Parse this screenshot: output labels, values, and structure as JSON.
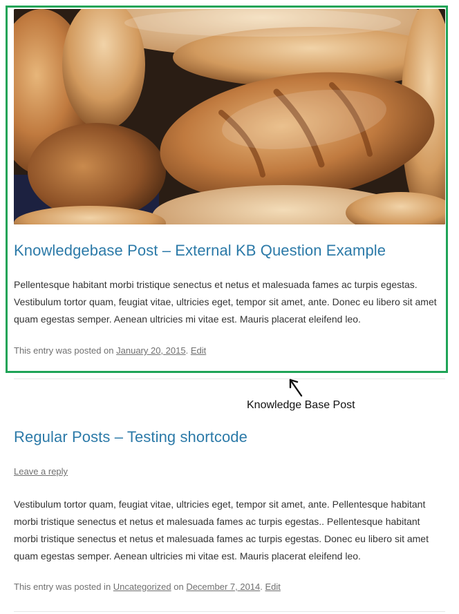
{
  "kb_post": {
    "title": "Knowledgebase Post – External KB Question Example",
    "excerpt": "Pellentesque habitant morbi tristique senectus et netus et malesuada fames ac turpis egestas. Vestibulum tortor quam, feugiat vitae, ultricies eget, tempor sit amet, ante. Donec eu libero sit amet quam egestas semper. Aenean ultricies mi vitae est. Mauris placerat eleifend leo.",
    "meta_prefix": "This entry was posted on ",
    "date": "January 20, 2015",
    "sep": ". ",
    "edit": "Edit",
    "image_icon": "bread-photo-icon",
    "highlight_color": "#1fa457"
  },
  "annotation": {
    "label": "Knowledge Base Post",
    "icon": "arrow-icon"
  },
  "regular_post": {
    "title": "Regular Posts – Testing shortcode",
    "reply": "Leave a reply",
    "body": "Vestibulum tortor quam, feugiat vitae, ultricies eget, tempor sit amet, ante. Pellentesque habitant morbi tristique senectus et netus et malesuada fames ac turpis egestas.. Pellentesque habitant morbi tristique senectus et netus et malesuada fames ac turpis egestas. Donec eu libero sit amet quam egestas semper. Aenean ultricies mi vitae est. Mauris placerat eleifend leo.",
    "meta_prefix": "This entry was posted in ",
    "category": "Uncategorized",
    "meta_on": " on ",
    "date": "December 7, 2014",
    "sep": ". ",
    "edit": "Edit"
  },
  "colors": {
    "link": "#2c7aa8",
    "meta": "#707070"
  }
}
